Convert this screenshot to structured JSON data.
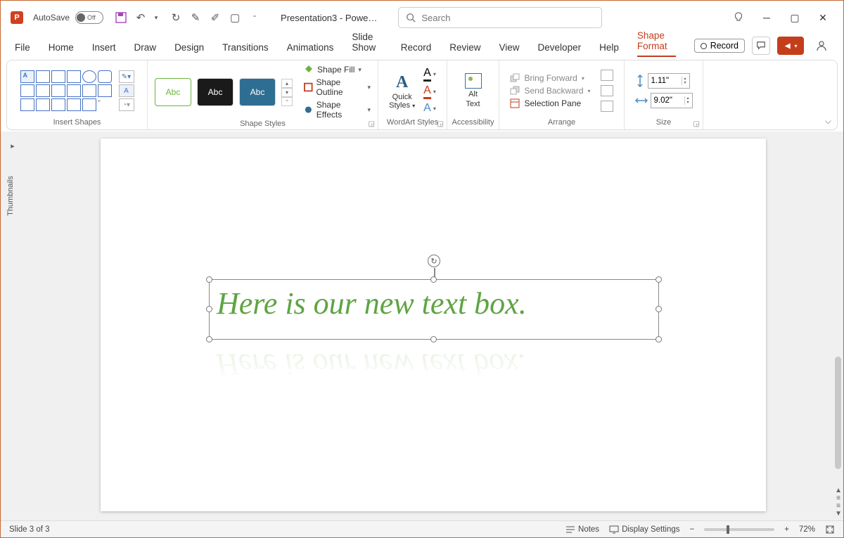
{
  "titlebar": {
    "app_letter": "P",
    "autosave_label": "AutoSave",
    "autosave_state": "Off",
    "doc_title": "Presentation3  -  Powe…",
    "search_placeholder": "Search"
  },
  "tabs": {
    "file": "File",
    "home": "Home",
    "insert": "Insert",
    "draw": "Draw",
    "design": "Design",
    "transitions": "Transitions",
    "animations": "Animations",
    "slideshow": "Slide Show",
    "record": "Record",
    "review": "Review",
    "view": "View",
    "developer": "Developer",
    "help": "Help",
    "shapeformat": "Shape Format",
    "record_btn": "Record"
  },
  "ribbon": {
    "insert_shapes": "Insert Shapes",
    "shape_styles": "Shape Styles",
    "style_abc": "Abc",
    "shape_fill": "Shape Fill",
    "shape_outline": "Shape Outline",
    "shape_effects": "Shape Effects",
    "wordart_styles": "WordArt Styles",
    "quick_styles": "Quick\nStyles",
    "quick_styles_1": "Quick",
    "quick_styles_2": "Styles",
    "accessibility": "Accessibility",
    "alt_text_1": "Alt",
    "alt_text_2": "Text",
    "arrange": "Arrange",
    "bring_forward": "Bring Forward",
    "send_backward": "Send Backward",
    "selection_pane": "Selection Pane",
    "size": "Size",
    "height": "1.11\"",
    "width": "9.02\""
  },
  "thumbnails_label": "Thumbnails",
  "slide": {
    "textbox_content": "Here is our new text box."
  },
  "statusbar": {
    "slide_info": "Slide 3 of 3",
    "notes": "Notes",
    "display_settings": "Display Settings",
    "zoom": "72%"
  }
}
